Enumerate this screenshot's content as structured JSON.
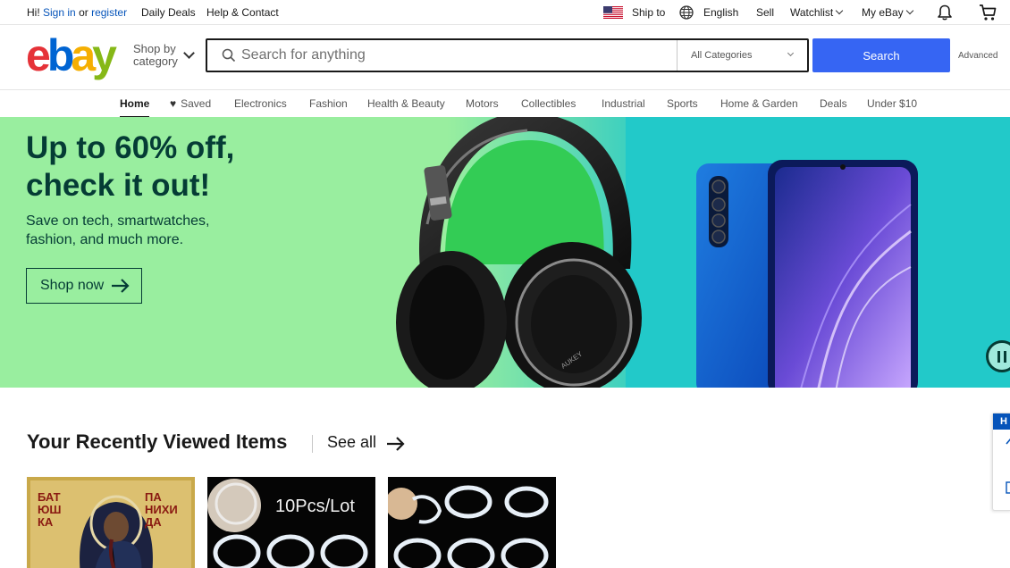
{
  "topbar": {
    "greeting": "Hi!",
    "sign_in": "Sign in",
    "or": "or",
    "register": "register",
    "daily_deals": "Daily Deals",
    "help_contact": "Help & Contact",
    "ship_to": "Ship to",
    "language": "English",
    "sell": "Sell",
    "watchlist": "Watchlist",
    "my_ebay": "My eBay"
  },
  "header": {
    "logo_letters": [
      "e",
      "b",
      "a",
      "y"
    ],
    "logo_colors": [
      "#e53238",
      "#0064d2",
      "#f5af02",
      "#86b817"
    ],
    "shop_by_line1": "Shop by",
    "shop_by_line2": "category",
    "search_placeholder": "Search for anything",
    "category_selected": "All Categories",
    "search_button": "Search",
    "advanced": "Advanced"
  },
  "nav": {
    "items": [
      "Home",
      "Saved",
      "Electronics",
      "Fashion",
      "Health & Beauty",
      "Motors",
      "Collectibles",
      "Industrial",
      "Sports",
      "Home & Garden",
      "Deals",
      "Under $10"
    ],
    "active": "Home"
  },
  "hero": {
    "title_line1": "Up to 60% off,",
    "title_line2": "check it out!",
    "subtitle": "Save on tech, smartwatches, fashion, and much more.",
    "button": "Shop now",
    "headphone_brand": "AUKEY",
    "colors": {
      "left_bg": "#99ee9f",
      "right_bg": "#22c9c9",
      "text": "#053c35"
    }
  },
  "recently_viewed": {
    "title": "Your Recently Viewed Items",
    "see_all": "See all",
    "items": [
      {
        "icon": "icon-painting",
        "caption_left": "БАТ ЮШ КА",
        "caption_right": "ПА НИХИ ДА"
      },
      {
        "icon": "ring-set",
        "label": "10Pcs/Lot"
      },
      {
        "icon": "ring-set"
      }
    ]
  },
  "sidetab": {
    "label": "H"
  },
  "accent": "#3665f3"
}
